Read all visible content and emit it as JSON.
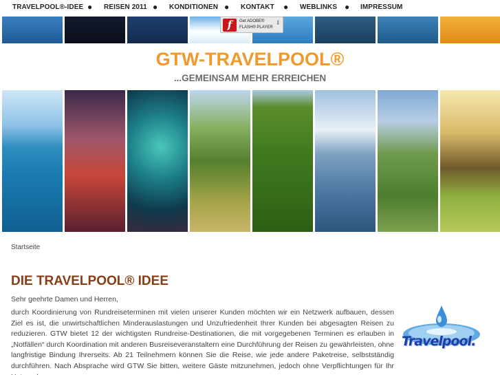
{
  "nav": {
    "items": [
      {
        "label": "TRAVELPOOL®-IDEE"
      },
      {
        "label": "REISEN 2011"
      },
      {
        "label": "KONDITIONEN"
      },
      {
        "label": "KONTAKT"
      },
      {
        "label": "WEBLINKS"
      },
      {
        "label": "IMPRESSUM"
      }
    ],
    "separator": "●"
  },
  "flash_badge": {
    "line1": "Get ADOBE®",
    "line2": "FLASH® PLAYER",
    "icon": "flash-icon"
  },
  "header": {
    "title": "GTW-TRAVELPOOL®",
    "subtitle": "...GEMEINSAM MEHR ERREICHEN"
  },
  "breadcrumb": "Startseite",
  "content": {
    "heading": "DIE TRAVELPOOL® IDEE",
    "greeting": "Sehr geehrte Damen und Herren,",
    "paragraph": "durch Koordinierung von Rundreiseterminen mit vielen unserer Kunden möchten wir ein Netzwerk aufbauen, dessen Ziel es ist, die unwirtschaftlichen Minderauslastungen und Unzufriedenheit Ihrer Kunden bei abgesagten Reisen zu reduzieren. GTW bietet 12 der wichtigsten Rundreise-Destinationen, die mit vorgegebenen Terminen es erlauben in „Notfällen“ durch Koordination mit anderen Busreiseveranstaltern eine Durchführung der Reisen zu gewährleisten, ohne langfristige Bindung Ihrerseits. Ab 21 Teilnehmern können Sie die Reise, wie jede andere Paketreise, selbstständig durchführen. Nach Absprache wird GTW Sie bitten, weitere Gäste mitzunehmen, jedoch ohne Verpflichtungen für Ihr Unternehmen."
  },
  "logo": {
    "text": "Travelpool."
  },
  "colors": {
    "title": "#f09a2d",
    "heading": "#8a3c12",
    "logo": "#1a3fa8"
  }
}
